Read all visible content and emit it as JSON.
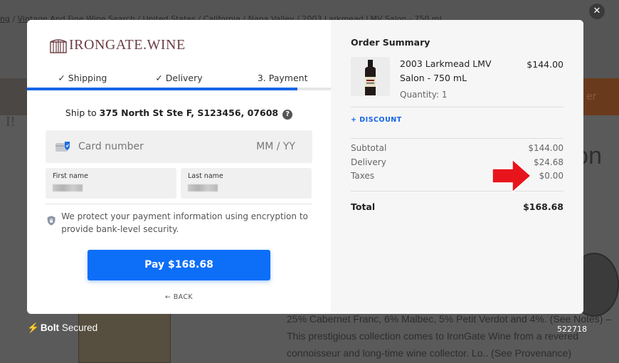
{
  "background": {
    "breadcrumb_parts": [
      "ng",
      "Vintage And Fine Wine Search",
      "United States",
      "California",
      "Napa Valley",
      "2003 Larkmead LMV Salon - 750 ml"
    ],
    "heading_fragment": "on",
    "side_letter": "I!",
    "description": "25% Cabernet Franc, 6% Malbec, 5% Petit Verdot and 4%. (See Notes) – This prestigious collection comes to IronGate Wine from a revered connoisseur and long-time wine collector. Lo.. (See Provenance)",
    "orange_button_fragment": "er"
  },
  "close_icon": "close-icon",
  "brand": {
    "logo_text": "IRONGATE.WINE",
    "accent": "#6b3d44"
  },
  "steps": [
    {
      "label": "✓ Shipping"
    },
    {
      "label": "✓ Delivery"
    },
    {
      "label": "3. Payment"
    }
  ],
  "progress_fraction": 0.89,
  "shipping": {
    "prefix": "Ship to",
    "address": "375 North St Ste F, S123456, 07608",
    "help": "?"
  },
  "payment": {
    "card_placeholder": "Card number",
    "expiry_placeholder": "MM / YY",
    "first_name_label": "First name",
    "last_name_label": "Last name",
    "security_note": "We protect your payment information using encryption to provide bank-level security.",
    "pay_label": "Pay $168.68",
    "back_label": "← BACK"
  },
  "summary": {
    "title": "Order Summary",
    "item": {
      "name": "2003 Larkmead LMV Salon - 750 mL",
      "quantity": "Quantity: 1",
      "price": "$144.00"
    },
    "discount_label": "+ DISCOUNT",
    "rows": [
      {
        "label": "Subtotal",
        "value": "$144.00"
      },
      {
        "label": "Delivery",
        "value": "$24.68"
      },
      {
        "label": "Taxes",
        "value": "$0.00"
      }
    ],
    "total_label": "Total",
    "total_value": "$168.68"
  },
  "footer": {
    "bolt_symbol": "⚡",
    "bolt_brand": "Bolt",
    "bolt_text": " Secured",
    "code": "522718"
  },
  "colors": {
    "primary_blue": "#0d6ef8",
    "arrow_red": "#e8141c"
  }
}
